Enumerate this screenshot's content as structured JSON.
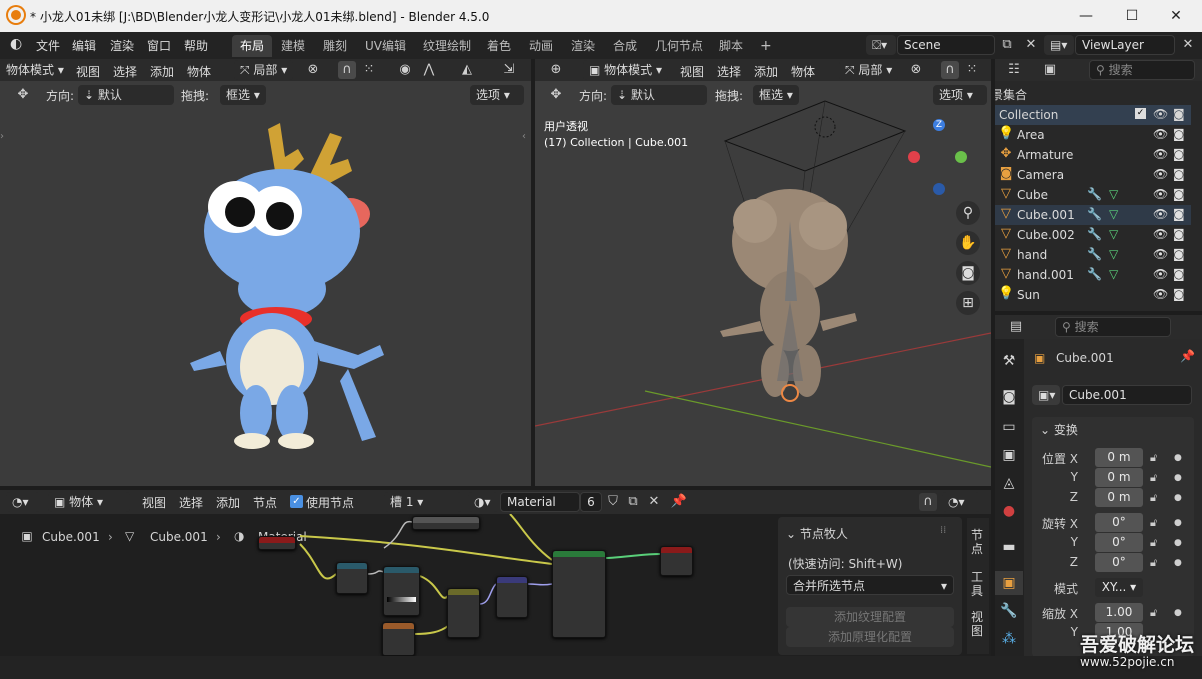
{
  "window": {
    "title": "* 小龙人01未绑 [J:\\BD\\Blender小龙人变形记\\小龙人01未绑.blend] - Blender 4.5.0",
    "controls": [
      "—",
      "☐",
      "✕"
    ]
  },
  "menu": [
    "文件",
    "编辑",
    "渲染",
    "窗口",
    "帮助"
  ],
  "workspaces": [
    "布局",
    "建模",
    "雕刻",
    "UV编辑",
    "纹理绘制",
    "着色",
    "动画",
    "渲染",
    "合成",
    "几何节点",
    "脚本"
  ],
  "active_workspace": "布局",
  "add_workspace": "+",
  "scene": "Scene",
  "view_layer": "ViewLayer",
  "viewport_left": {
    "mode": "物体模式",
    "menus": [
      "视图",
      "选择",
      "添加",
      "物体"
    ],
    "orientation": "局部",
    "orient_label": "方向:",
    "orient_value": "默认",
    "drag_label": "拖拽:",
    "drag_value": "框选",
    "options": "选项"
  },
  "viewport_right": {
    "mode": "物体模式",
    "menus": [
      "视图",
      "选择",
      "添加",
      "物体"
    ],
    "orientation": "局部",
    "orient_label": "方向:",
    "orient_value": "默认",
    "drag_label": "拖拽:",
    "drag_value": "框选",
    "options": "选项",
    "view_name": "用户透视",
    "view_info": "(17) Collection | Cube.001",
    "gizmo_axis": "Z"
  },
  "outliner": {
    "search_placeholder": "搜索",
    "scene_collection": "景集合",
    "collection": "Collection",
    "items": [
      {
        "name": "Area",
        "icon": "light-icon"
      },
      {
        "name": "Armature",
        "icon": "armature-icon"
      },
      {
        "name": "Camera",
        "icon": "camera-icon"
      },
      {
        "name": "Cube",
        "icon": "mesh-icon"
      },
      {
        "name": "Cube.001",
        "icon": "mesh-icon"
      },
      {
        "name": "Cube.002",
        "icon": "mesh-icon"
      },
      {
        "name": "hand",
        "icon": "mesh-icon"
      },
      {
        "name": "hand.001",
        "icon": "mesh-icon"
      },
      {
        "name": "Sun",
        "icon": "light-icon"
      }
    ]
  },
  "properties": {
    "search_placeholder": "搜索",
    "object_name": "Cube.001",
    "object_field": "Cube.001",
    "section": "变换",
    "location_label": "位置 X",
    "location": [
      "0 m",
      "0 m",
      "0 m"
    ],
    "rotation_label": "旋转 X",
    "rotation": [
      "0°",
      "0°",
      "0°"
    ],
    "axis_y": "Y",
    "axis_z": "Z",
    "mode_label": "模式",
    "mode_value": "XY...",
    "scale_label": "缩放 X",
    "scale": [
      "1.00",
      "1.00"
    ]
  },
  "node_editor": {
    "editor_type": "物体",
    "menus": [
      "视图",
      "选择",
      "添加",
      "节点"
    ],
    "use_nodes": "使用节点",
    "slot": "槽 1",
    "material": "Material",
    "users": "6",
    "breadcrumb": [
      "Cube.001",
      "Cube.001",
      "Material"
    ],
    "panel_title": "节点牧人",
    "quick_access": "(快速访问: Shift+W)",
    "merge_select": "合并所选节点",
    "add_texture": "添加纹理配置",
    "add_principled": "添加原理化配置",
    "side_tabs": [
      "节点",
      "工具",
      "视图"
    ]
  },
  "watermark": {
    "title": "吾爱破解论坛",
    "url": "www.52pojie.cn"
  }
}
